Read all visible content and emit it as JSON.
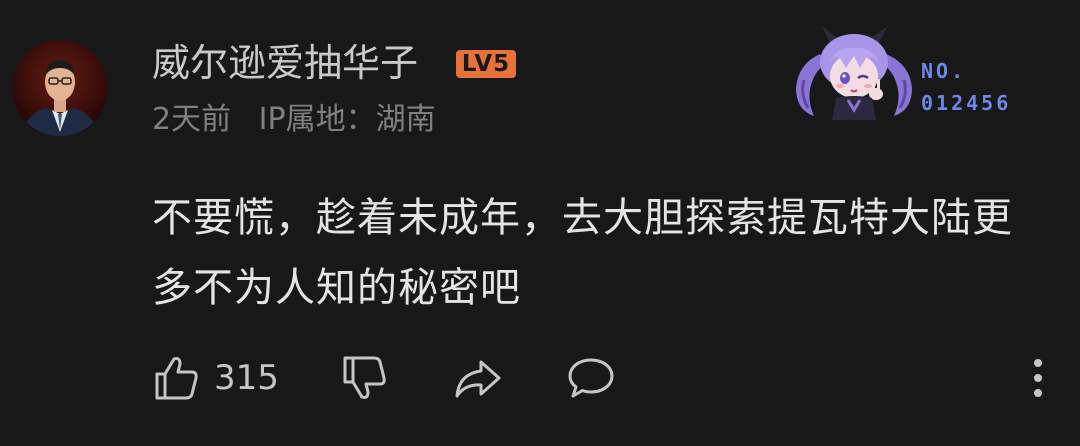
{
  "comment": {
    "username": "威尔逊爱抽华子",
    "level": "LV5",
    "time": "2天前",
    "ip_location": "IP属地：湖南",
    "text": "不要慌，趁着未成年，去大胆探索提瓦特大陆更多不为人知的秘密吧"
  },
  "pendant": {
    "label": "NO.",
    "number": "012456"
  },
  "actions": {
    "like_count": "315"
  },
  "icons": {
    "like": "thumbs-up-icon",
    "dislike": "thumbs-down-icon",
    "share": "share-icon",
    "reply": "comment-icon",
    "more": "more-vertical-icon"
  },
  "colors": {
    "background": "#181818",
    "level_badge": "#e8703a",
    "pendant_accent": "#6e86ea",
    "muted_text": "#808080"
  }
}
